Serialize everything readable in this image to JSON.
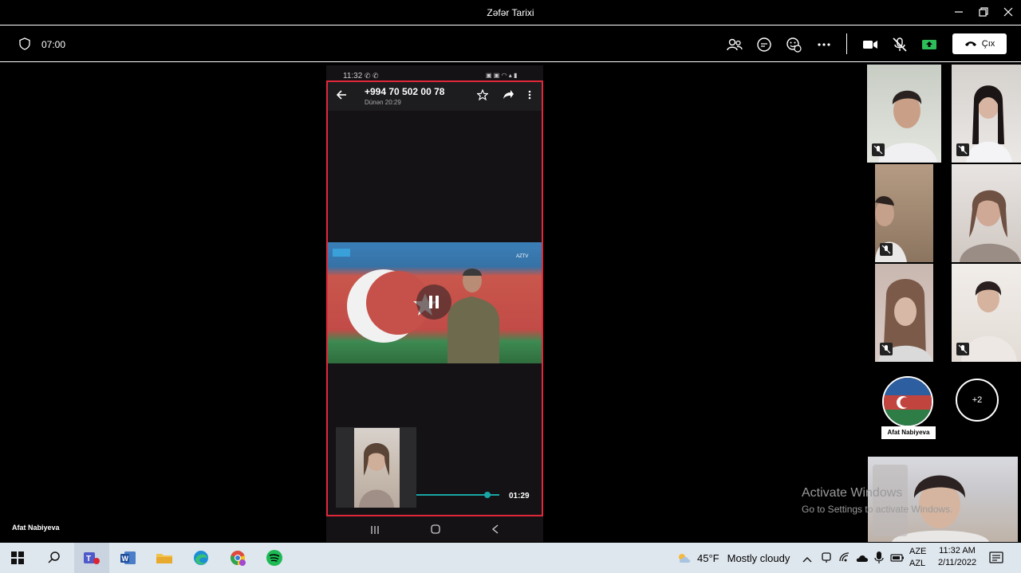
{
  "window": {
    "title": "Zəfər Tarixi"
  },
  "toolbar": {
    "timer": "07:00",
    "leave_label": "Çıx",
    "colors": {
      "share_active": "#2ebd59"
    }
  },
  "phone": {
    "status_time": "11:32",
    "contact": "+994 70 502 00 78",
    "subtitle": "Dünən 20:29",
    "video_badge": "AZTV",
    "duration": "01:29",
    "progress": 0.86,
    "frame_color": "#e0283a"
  },
  "stage": {
    "presenter_name": "Afat Nabiyeva"
  },
  "participants": {
    "avatar_name": "Afat Nabiyeva",
    "overflow_count": "+2"
  },
  "watermark": {
    "line1": "Activate Windows",
    "line2": "Go to Settings to activate Windows."
  },
  "taskbar": {
    "weather_temp": "45°F",
    "weather_text": "Mostly cloudy",
    "lang_top": "AZE",
    "lang_bottom": "AZL",
    "time": "11:32 AM",
    "date": "2/11/2022"
  }
}
